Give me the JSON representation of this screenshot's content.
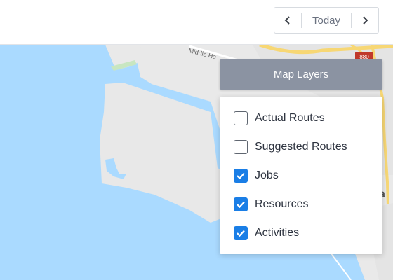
{
  "toolbar": {
    "prev_icon": "chevron-left-icon",
    "today_label": "Today",
    "next_icon": "chevron-right-icon"
  },
  "map": {
    "street_label": "Middle Ha",
    "highway_badge": "880",
    "city_fragment": "a"
  },
  "layers": {
    "title": "Map Layers",
    "items": [
      {
        "label": "Actual Routes",
        "checked": false
      },
      {
        "label": "Suggested Routes",
        "checked": false
      },
      {
        "label": "Jobs",
        "checked": true
      },
      {
        "label": "Resources",
        "checked": true
      },
      {
        "label": "Activities",
        "checked": true
      }
    ]
  },
  "colors": {
    "water": "#aadaff",
    "land": "#e8e8e8",
    "header_bg": "#8b93a2",
    "checkbox_checked": "#1a7ee6"
  }
}
